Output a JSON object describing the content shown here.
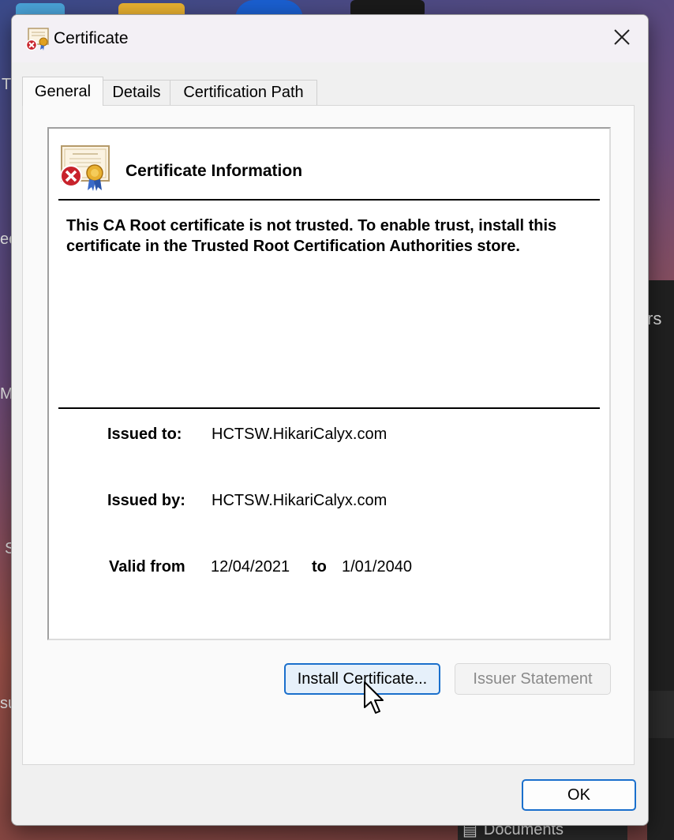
{
  "window": {
    "title": "Certificate",
    "close_glyph": "✕"
  },
  "tabs": [
    {
      "label": "General",
      "active": true
    },
    {
      "label": "Details",
      "active": false
    },
    {
      "label": "Certification Path",
      "active": false
    }
  ],
  "general": {
    "heading": "Certificate Information",
    "warning": "This CA Root certificate is not trusted. To enable trust, install this certificate in the Trusted Root Certification Authorities store.",
    "issued_to_label": "Issued to:",
    "issued_to": "HCTSW.HikariCalyx.com",
    "issued_by_label": "Issued by:",
    "issued_by": "HCTSW.HikariCalyx.com",
    "valid_from_label": "Valid from",
    "valid_from": "12/04/2021",
    "to_label": "to",
    "valid_to": "1/01/2040"
  },
  "buttons": {
    "install": "Install Certificate...",
    "issuer": "Issuer Statement",
    "ok": "OK"
  },
  "background": {
    "right_panel_text": "rs",
    "taskbar_doc": "Documents",
    "left_fragments": [
      "T",
      "ec",
      "M",
      "S",
      "su"
    ]
  },
  "icons": {
    "certificate": "certificate-icon",
    "error_badge": "error-badge-icon",
    "close": "close-icon",
    "pointer": "mouse-pointer-icon"
  },
  "colors": {
    "accent": "#1a6fcc",
    "error": "#c8232c",
    "seal": "#e0a020"
  }
}
